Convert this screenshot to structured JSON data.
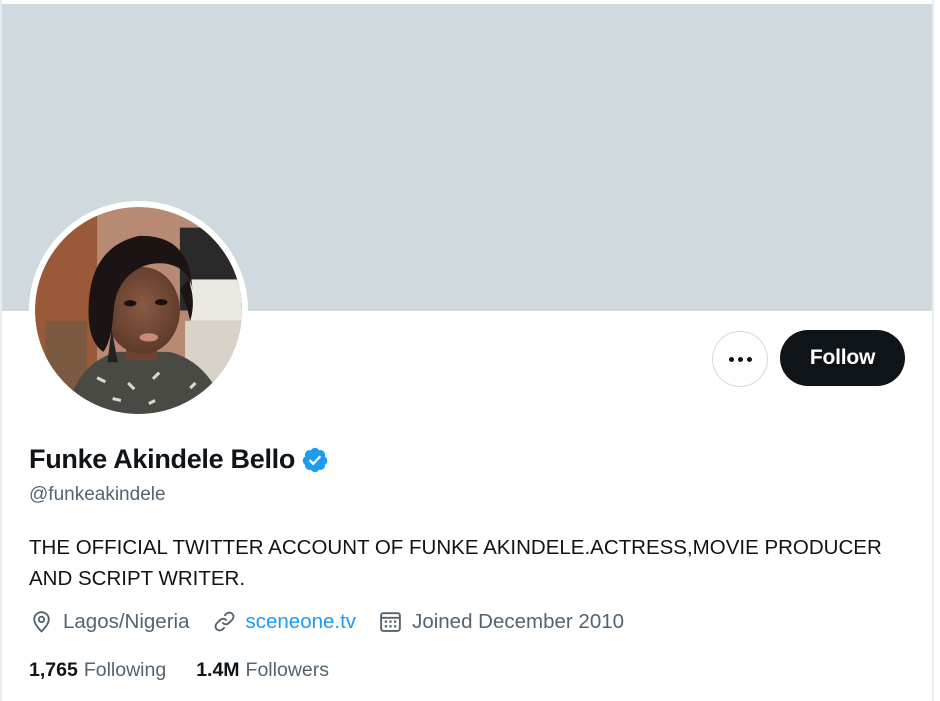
{
  "profile": {
    "name": "Funke Akindele Bello",
    "handle": "@funkeakindele",
    "bio": "THE OFFICIAL TWITTER ACCOUNT OF FUNKE AKINDELE.ACTRESS,MOVIE PRODUCER AND SCRIPT WRITER.",
    "verified": true
  },
  "actions": {
    "follow_label": "Follow",
    "more_icon": "more-horizontal-icon"
  },
  "meta": {
    "location": "Lagos/Nigeria",
    "website": "sceneone.tv",
    "joined": "Joined December 2010"
  },
  "stats": {
    "following_count": "1,765",
    "following_label": "Following",
    "followers_count": "1.4M",
    "followers_label": "Followers"
  },
  "colors": {
    "banner": "#cfd9de",
    "text_primary": "#0f1419",
    "text_secondary": "#536471",
    "link": "#1d9bf0",
    "verified": "#1d9bf0",
    "follow_button": "#0f1419"
  },
  "icons": {
    "verified": "verified-badge-icon",
    "location": "location-pin-icon",
    "website": "link-icon",
    "joined": "calendar-icon"
  }
}
